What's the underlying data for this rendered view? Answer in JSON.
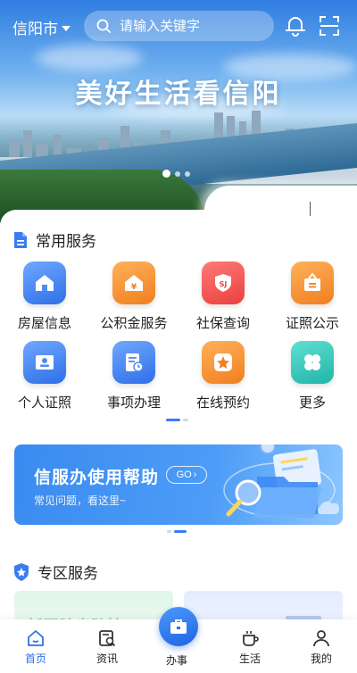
{
  "header": {
    "city": "信阳市",
    "search_placeholder": "请输入关键字",
    "banner_title": "美好生活看信阳",
    "icons": [
      "bell-icon",
      "scan-icon",
      "search-icon"
    ]
  },
  "common_services": {
    "title": "常用服务",
    "items": [
      {
        "label": "房屋信息",
        "icon": "house-icon",
        "color": "#2f6fe8"
      },
      {
        "label": "公积金服务",
        "icon": "yen-house-icon",
        "color": "#f07f1e"
      },
      {
        "label": "社保查询",
        "icon": "social-security-icon",
        "color": "#e9403f"
      },
      {
        "label": "证照公示",
        "icon": "certificate-icon",
        "color": "#f07f1e"
      },
      {
        "label": "个人证照",
        "icon": "id-card-icon",
        "color": "#2f6fe8"
      },
      {
        "label": "事项办理",
        "icon": "document-clock-icon",
        "color": "#2f6fe8"
      },
      {
        "label": "在线预约",
        "icon": "star-icon",
        "color": "#f07f1e"
      },
      {
        "label": "更多",
        "icon": "clover-icon",
        "color": "#20b5a9"
      }
    ]
  },
  "help_banner": {
    "title": "信服办使用帮助",
    "go_label": "GO",
    "subtitle": "常见问题，看这里~"
  },
  "zone": {
    "title": "专区服务",
    "card1_text": "新冠肺炎防控"
  },
  "bottom_nav": {
    "items": [
      {
        "label": "首页",
        "icon": "home-icon",
        "active": true
      },
      {
        "label": "资讯",
        "icon": "news-icon",
        "active": false
      },
      {
        "label": "办事",
        "icon": "briefcase-icon",
        "active": false
      },
      {
        "label": "生活",
        "icon": "coffee-cup-icon",
        "active": false
      },
      {
        "label": "我的",
        "icon": "user-icon",
        "active": false
      }
    ]
  },
  "colors": {
    "accent": "#2f6fe8",
    "active_nav": "#2f6fe8"
  }
}
